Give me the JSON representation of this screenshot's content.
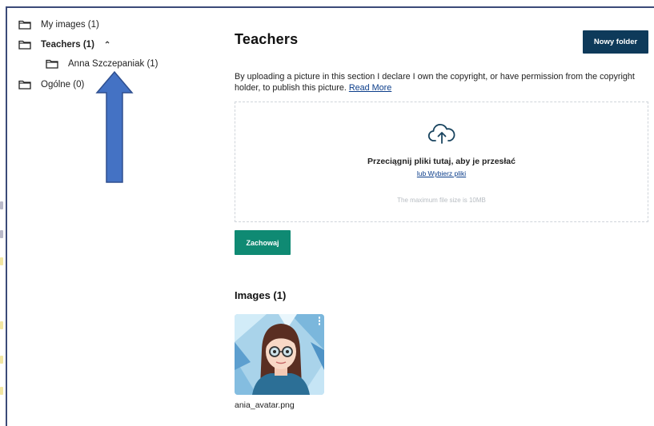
{
  "sidebar": {
    "items": [
      {
        "label": "My images (1)"
      },
      {
        "label": "Teachers (1)"
      },
      {
        "label": "Anna Szczepaniak (1)"
      },
      {
        "label": "Ogólne (0)"
      }
    ],
    "expanded_chevron": "chevron-up-icon",
    "folder_icon": "folder-icon"
  },
  "main": {
    "title": "Teachers",
    "new_folder_label": "Nowy folder",
    "description": "By uploading a picture in this section I declare I own the copyright, or have permission from the copyright holder, to publish this picture.",
    "read_more_label": "Read More",
    "dropzone": {
      "icon": "cloud-upload-icon",
      "title": "Przeciągnij pliki tutaj, aby je przesłać",
      "choose_link": "lub Wybierz pliki",
      "hint": "The maximum file size is 10MB"
    },
    "save_label": "Zachowaj",
    "images_header": "Images (1)",
    "images": [
      {
        "filename": "ania_avatar.png"
      }
    ]
  },
  "colors": {
    "primary_dark": "#0e3a5a",
    "save_green": "#0f8a73",
    "link_blue": "#0b3d8a",
    "annotation_arrow": "#4472c4"
  },
  "annotation": {
    "type": "arrow",
    "direction": "up",
    "target": "Anna Szczepaniak (1)"
  }
}
